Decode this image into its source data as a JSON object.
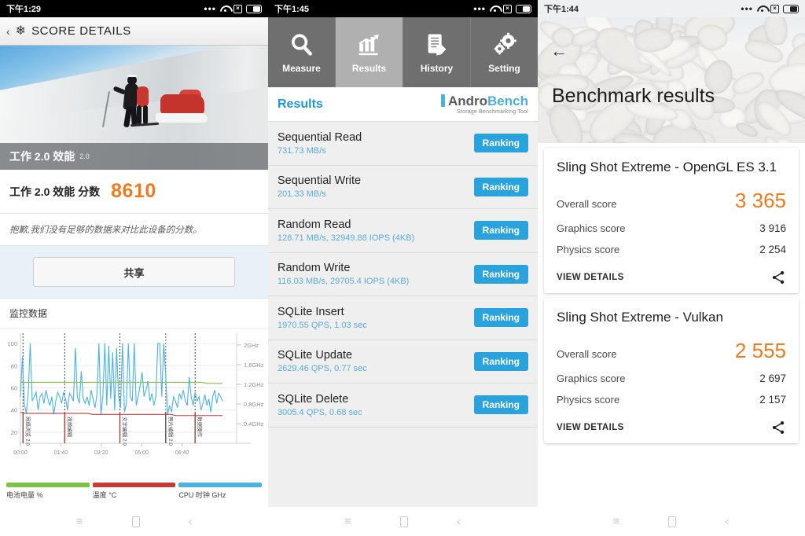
{
  "panels": {
    "pcmark": {
      "status": {
        "time": "下午1:29",
        "dots": "•••",
        "wifi": "wifi-icon",
        "sim": "x",
        "battery": "battery-icon"
      },
      "header": {
        "back": "‹",
        "icon": "snowflake-icon",
        "title": "SCORE DETAILS"
      },
      "hero": {
        "band_title": "工作 2.0 效能",
        "band_sub": "2.0"
      },
      "score": {
        "label": "工作 2.0 效能 分数",
        "value": "8610",
        "color": "#f07b1d"
      },
      "note": "抱歉,我们没有足够的数据来对比此设备的分数。",
      "share_button": "共享",
      "section_title": "监控数据",
      "chart_legend": [
        {
          "label": "电池电量 %",
          "color": "#7dc242"
        },
        {
          "label": "温度 °C",
          "color": "#c63b35"
        },
        {
          "label": "CPU 时钟 GHz",
          "color": "#4ab3e3"
        }
      ]
    },
    "androbench": {
      "status": {
        "time": "下午1:45"
      },
      "tabs": [
        {
          "label": "Measure",
          "icon": "magnifier-icon",
          "active": false
        },
        {
          "label": "Results",
          "icon": "bar-chart-icon",
          "active": true
        },
        {
          "label": "History",
          "icon": "document-pen-icon",
          "active": false
        },
        {
          "label": "Setting",
          "icon": "gears-icon",
          "active": false
        }
      ],
      "results_title": "Results",
      "logo": {
        "part1": "Andro",
        "part2": "Bench",
        "tagline": "Storage Benchmarking Tool"
      },
      "rows": [
        {
          "name": "Sequential Read",
          "value": "731.73 MB/s",
          "action": "Ranking"
        },
        {
          "name": "Sequential Write",
          "value": "201.33 MB/s",
          "action": "Ranking"
        },
        {
          "name": "Random Read",
          "value": "128.71 MB/s, 32949.88 IOPS (4KB)",
          "action": "Ranking"
        },
        {
          "name": "Random Write",
          "value": "116.03 MB/s, 29705.4 IOPS (4KB)",
          "action": "Ranking"
        },
        {
          "name": "SQLite Insert",
          "value": "1970.55 QPS, 1.03 sec",
          "action": "Ranking"
        },
        {
          "name": "SQLite Update",
          "value": "2629.46 QPS, 0.77 sec",
          "action": "Ranking"
        },
        {
          "name": "SQLite Delete",
          "value": "3005.4 QPS, 0.68 sec",
          "action": "Ranking"
        }
      ]
    },
    "threedmark": {
      "status": {
        "time": "下午1:44"
      },
      "back": "←",
      "title": "Benchmark results",
      "cards": [
        {
          "title": "Sling Shot Extreme - OpenGL ES 3.1",
          "overall_label": "Overall score",
          "overall_value": "3 365",
          "graphics_label": "Graphics score",
          "graphics_value": "3 916",
          "physics_label": "Physics score",
          "physics_value": "2 254",
          "view_details": "VIEW DETAILS",
          "share_icon": "share-icon"
        },
        {
          "title": "Sling Shot Extreme - Vulkan",
          "overall_label": "Overall score",
          "overall_value": "2 555",
          "graphics_label": "Graphics score",
          "graphics_value": "2 697",
          "physics_label": "Physics score",
          "physics_value": "2 157",
          "view_details": "VIEW DETAILS",
          "share_icon": "share-icon"
        }
      ]
    }
  },
  "navbar": {
    "menu": "≡",
    "home": "home-icon",
    "back": "‹"
  },
  "chart_data": {
    "type": "line",
    "title": "监控数据",
    "xlabel": "",
    "ylabel": "",
    "grid": true,
    "legend_position": "bottom",
    "x_ticks": [
      "00:00",
      "01:40",
      "03:20",
      "05:00",
      "06:40"
    ],
    "y_left_ticks": [
      20,
      40,
      60,
      80,
      100
    ],
    "ylim": [
      10,
      105
    ],
    "y_right_ticks": [
      "0.4GHz",
      "0.8GHz",
      "1.2GHz",
      "1.6GHz",
      "2GHz"
    ],
    "y_right_lim": [
      0,
      2.2
    ],
    "annotations": [
      {
        "x": "00:05",
        "label": "网络浏览 2.0",
        "color": "#8d4a3a"
      },
      {
        "x": "01:10",
        "label": "视频编辑",
        "color": "#c0392b"
      },
      {
        "x": "02:35",
        "label": "文字编辑 2.0",
        "color": "#8d4a3a"
      },
      {
        "x": "04:00",
        "label": "照片编辑 2.0",
        "color": "#555555"
      },
      {
        "x": "04:50",
        "label": "数据操作",
        "color": "#8d4a3a"
      }
    ],
    "series": [
      {
        "name": "电池电量 %",
        "color": "#7dc242",
        "unit": "%",
        "axis": "left",
        "values": [
          65,
          65,
          65,
          65,
          65,
          65,
          65,
          65,
          65,
          65,
          65,
          65,
          65,
          65,
          65,
          65,
          65,
          65,
          65,
          65,
          65,
          65,
          65,
          65,
          65,
          65,
          65,
          65,
          65,
          65,
          65,
          65,
          65,
          65,
          65,
          65,
          64,
          64,
          64,
          64
        ]
      },
      {
        "name": "温度 °C",
        "color": "#c63b35",
        "unit": "°C",
        "axis": "left",
        "values": [
          38,
          37,
          37,
          37,
          37,
          37,
          37,
          37,
          37,
          37,
          37,
          37,
          37,
          37,
          36,
          36,
          36,
          36,
          36,
          36,
          36,
          36,
          36,
          36,
          36,
          36,
          36,
          36,
          36,
          36,
          35,
          35,
          35,
          35,
          35,
          35,
          35,
          35,
          35,
          35
        ]
      },
      {
        "name": "CPU 时钟 GHz",
        "color": "#4ab3e3",
        "unit": "GHz",
        "axis": "right",
        "note": "CPU clock plotted as percent of max (2.2GHz); highly oscillating 30–100",
        "values": [
          52,
          88,
          45,
          37,
          56,
          100,
          48,
          52,
          56,
          40,
          52,
          55,
          46,
          58,
          50,
          44,
          52,
          36,
          48,
          56,
          52,
          46,
          56,
          50,
          40,
          55,
          52,
          48,
          96,
          52,
          46,
          75,
          50,
          46,
          52,
          44,
          58,
          50,
          42,
          54,
          100,
          36,
          52,
          100,
          44,
          98,
          50,
          92,
          40,
          96,
          52,
          42,
          100,
          38,
          46,
          100,
          52,
          48,
          100,
          44,
          52,
          62,
          74,
          52,
          58,
          66,
          48,
          55,
          44,
          52,
          100,
          100,
          52,
          100,
          72,
          36,
          44,
          38,
          52,
          48,
          42,
          55,
          50,
          58,
          48,
          44,
          70,
          52,
          44,
          56,
          48,
          52,
          40,
          46,
          54,
          44,
          50,
          38,
          52,
          58,
          46,
          55,
          52,
          48
        ]
      }
    ]
  }
}
